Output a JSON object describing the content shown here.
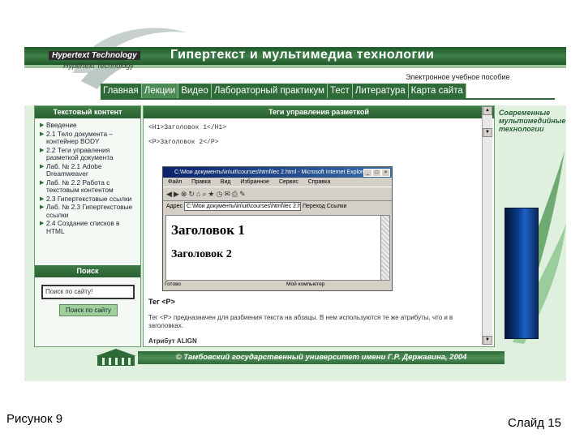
{
  "site": {
    "logo_line1": "Hypertext Technology",
    "logo_line2": "Hypertext Technology",
    "title": "Гипертекст и мультимедиа технологии",
    "subtitle": "Электронное учебное пособие"
  },
  "nav": {
    "items": [
      "Главная",
      "Лекции",
      "Видео",
      "Лабораторный практикум",
      "Тест",
      "Литература",
      "Карта сайта"
    ],
    "active_index": 1
  },
  "left": {
    "content_header": "Текстовый контент",
    "toc": [
      "Введение",
      "2.1 Тело документа – контейнер BODY",
      "2.2 Теги управления разметкой документа",
      "Лаб. № 2.1 Adobe Dreamweaver",
      "Лаб. № 2.2 Работа с текстовым контентом",
      "2.3 Гипертекстовые ссылки",
      "Лаб. № 2.3 Гипертекстовые ссылки",
      "2.4 Создание списков в HTML"
    ],
    "search_header": "Поиск",
    "search_placeholder": "Поиск по сайту!",
    "search_button": "Поиск по сайту"
  },
  "main": {
    "header": "Теги управления разметкой",
    "code_line1": "<H1>Заголовок 1</H1>",
    "code_line2": "<P>Заголовок 2</P>",
    "browser": {
      "title": "C:\\Мои документы\\in\\uit\\courses\\html\\lec 2.html - Microsoft Internet Explorer",
      "menu": [
        "Файл",
        "Правка",
        "Вид",
        "Избранное",
        "Сервис",
        "Справка"
      ],
      "address_label": "Адрес",
      "address": "C:\\Мои документы\\in\\uit\\courses\\html\\lec 2.html",
      "go_label": "Переход",
      "links_label": "Ссылки",
      "heading1": "Заголовок 1",
      "heading2": "Заголовок 2",
      "status_left": "Готово",
      "status_right": "Мой компьютер"
    },
    "tag_p_title": "Тег <P>",
    "tag_p_text": "Тег <P> предназначен для разбиения текста на абзацы. В нем используются те же атрибуты, что и в заголовках.",
    "attr_label": "Атрибут ALIGN"
  },
  "right": {
    "book_title": "Современные мультимедийные технологии"
  },
  "footer": {
    "text": "© Тамбовский государственный университет имени Г.Р. Державина, 2004"
  },
  "slide": {
    "caption_left": "Рисунок 9",
    "caption_right": "Слайд 15"
  },
  "colors": {
    "brand_green": "#2e6b38",
    "page_bg": "#dff1de"
  }
}
